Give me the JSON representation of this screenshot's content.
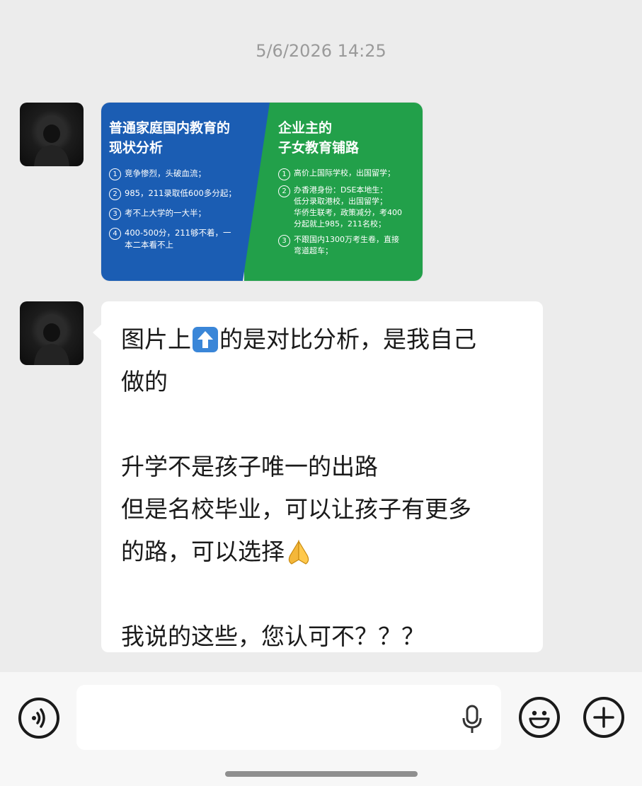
{
  "timestamp": "5/6/2026 14:25",
  "image_message": {
    "left": {
      "title": "普通家庭国内教育的\n现状分析",
      "items": [
        {
          "num": "1",
          "text": "竞争惨烈，头破血流；"
        },
        {
          "num": "2",
          "text": "985，211录取低600多分起；"
        },
        {
          "num": "3",
          "text": "考不上大学的一大半；"
        },
        {
          "num": "4",
          "text": "400-500分，211够不着，一\n本二本看不上"
        }
      ]
    },
    "right": {
      "title": "企业主的\n子女教育铺路",
      "items": [
        {
          "num": "1",
          "text": "高价上国际学校，出国留学；"
        },
        {
          "num": "2",
          "text": "办香港身份：DSE本地生：\n低分录取港校，出国留学；\n华侨生联考，政策减分，考400\n分起就上985，211名校；"
        },
        {
          "num": "3",
          "text": "不跟国内1300万考生卷，直接\n弯道超车；"
        }
      ]
    },
    "colors": {
      "left_panel": "#1b5db3",
      "right_panel": "#22a04a"
    }
  },
  "text_message": {
    "line1_before": "图片上",
    "line1_emoji": "up-arrow-emoji",
    "line1_after": "的是对比分析，是我自己",
    "line2": "做的",
    "line3": "升学不是孩子唯一的出路",
    "line4": "但是名校毕业，可以让孩子有更多",
    "line5_text": "的路，可以选择",
    "line5_emoji": "praying-hands-emoji",
    "line6": "我说的这些，您认可不？？？"
  },
  "input_bar": {
    "value": "",
    "icons": [
      "voice-icon",
      "microphone-icon",
      "emoji-icon",
      "plus-icon"
    ]
  }
}
